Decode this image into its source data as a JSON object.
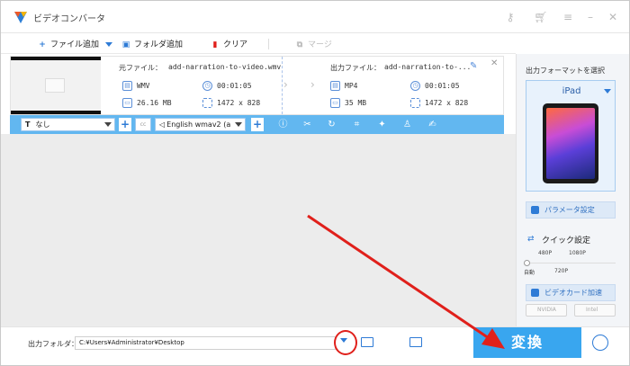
{
  "window": {
    "title": "ビデオコンバータ"
  },
  "toolbar": {
    "add_file": "ファイル追加",
    "add_folder": "フォルダ追加",
    "clear": "クリア",
    "merge": "マージ"
  },
  "file": {
    "source_label": "元ファイル：",
    "source_name": "add-narration-to-video.wmv",
    "source_format": "WMV",
    "source_duration": "00:01:05",
    "source_size": "26.16 MB",
    "source_resolution": "1472 x 828",
    "output_label": "出力ファイル：",
    "output_name": "add-narration-to-...",
    "output_format": "MP4",
    "output_duration": "00:01:05",
    "output_size": "35 MB",
    "output_resolution": "1472 x 828"
  },
  "editbar": {
    "subtitle_select": "なし",
    "audio_select": "English wmav2 (a"
  },
  "right_panel": {
    "title": "出力フォーマットを選択",
    "format": "iPad",
    "param_button": "パラメータ設定",
    "quick_title": "クイック設定",
    "q_480": "480P",
    "q_1080": "1080P",
    "q_auto": "自動",
    "q_720": "720P",
    "gpu_button": "ビデオカード加速",
    "nvidia": "NVIDIA",
    "intel": "Intel"
  },
  "bottom": {
    "output_folder_label": "出力フォルダ：",
    "output_folder_value": "C:¥Users¥Administrator¥Desktop",
    "convert_button": "変換"
  },
  "colors": {
    "accent": "#39a6ef",
    "editbar": "#62b7f0",
    "annotation_red": "#e0201b"
  }
}
